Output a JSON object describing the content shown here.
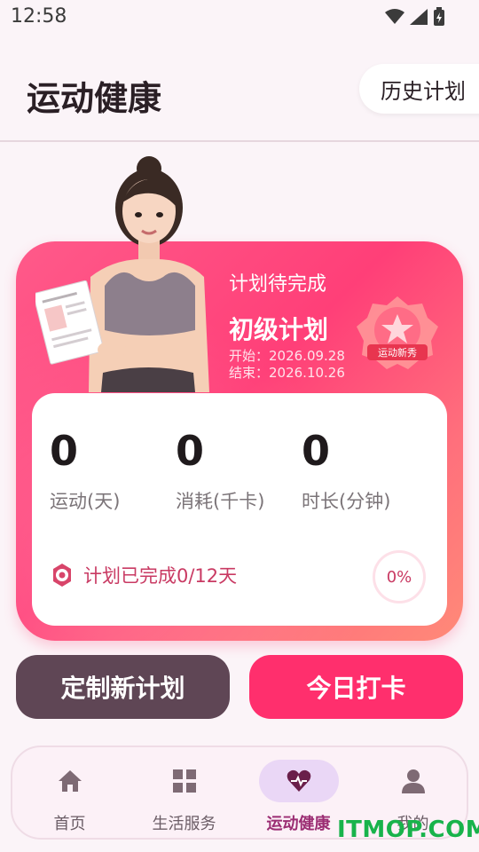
{
  "status_bar": {
    "time": "12:58"
  },
  "header": {
    "title": "运动健康",
    "history_button": "历史计划"
  },
  "plan": {
    "status": "计划待完成",
    "name": "初级计划",
    "start": "开始：2026.09.28",
    "end": "结束：2026.10.26",
    "badge_text": "运动新秀"
  },
  "stats": [
    {
      "value": "0",
      "label": "运动(天)"
    },
    {
      "value": "0",
      "label": "消耗(千卡)"
    },
    {
      "value": "0",
      "label": "时长(分钟)"
    }
  ],
  "progress": {
    "text": "计划已完成0/12天",
    "percent_label": "0%",
    "percent": 0
  },
  "actions": {
    "custom_plan": "定制新计划",
    "check_in": "今日打卡"
  },
  "tabs": [
    {
      "label": "首页",
      "icon": "home-icon"
    },
    {
      "label": "生活服务",
      "icon": "grid-icon"
    },
    {
      "label": "运动健康",
      "icon": "heart-pulse-icon",
      "active": true
    },
    {
      "label": "我的",
      "icon": "person-icon"
    }
  ],
  "watermark": "ITMOP.COM",
  "colors": {
    "accent": "#ff2f6d",
    "dark_button": "#5f4655",
    "active_tab": "#9b2d73"
  }
}
